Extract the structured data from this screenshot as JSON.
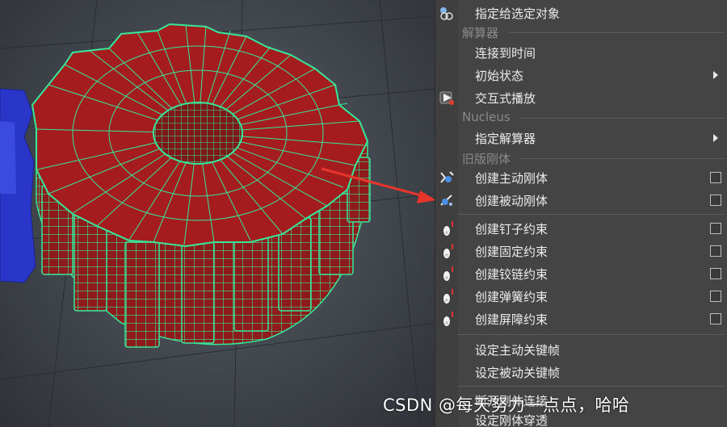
{
  "menu": {
    "top_item": {
      "label": "指定给选定对象",
      "icon": "assign-object-icon"
    },
    "solvers_section": "解算器",
    "solver_items": [
      {
        "label": "连接到时间"
      },
      {
        "label": "初始状态",
        "submenu": true
      },
      {
        "label": "交互式播放",
        "icon": "interactive-playback-icon"
      }
    ],
    "nucleus_section": "Nucleus",
    "nucleus_items": [
      {
        "label": "指定解算器",
        "submenu": true
      }
    ],
    "legacy_section": "旧版刚体",
    "rigid_items": [
      {
        "label": "创建主动刚体",
        "icon": "active-rigid-body-icon",
        "option_box": true
      },
      {
        "label": "创建被动刚体",
        "icon": "passive-rigid-body-icon",
        "option_box": true
      }
    ],
    "constraint_items": [
      {
        "label": "创建钉子约束",
        "icon": "nail-constraint-icon",
        "option_box": true
      },
      {
        "label": "创建固定约束",
        "icon": "pin-constraint-icon",
        "option_box": true
      },
      {
        "label": "创建铰链约束",
        "icon": "hinge-constraint-icon",
        "option_box": true
      },
      {
        "label": "创建弹簧约束",
        "icon": "spring-constraint-icon",
        "option_box": true
      },
      {
        "label": "创建屏障约束",
        "icon": "barrier-constraint-icon",
        "option_box": true
      }
    ],
    "keyframe_items": [
      {
        "label": "设定主动关键帧"
      },
      {
        "label": "设定被动关键帧"
      }
    ],
    "bottom_items": [
      {
        "label": "断开刚体连接"
      },
      {
        "label": "设定刚体穿透"
      }
    ]
  },
  "watermark": "CSDN @每天努力一点点，哈哈",
  "colors": {
    "gear_fill": "#a51c1e",
    "wire": "#3cf0a0",
    "blue_object": "#2a3bd0",
    "arrow": "#e8352c"
  }
}
